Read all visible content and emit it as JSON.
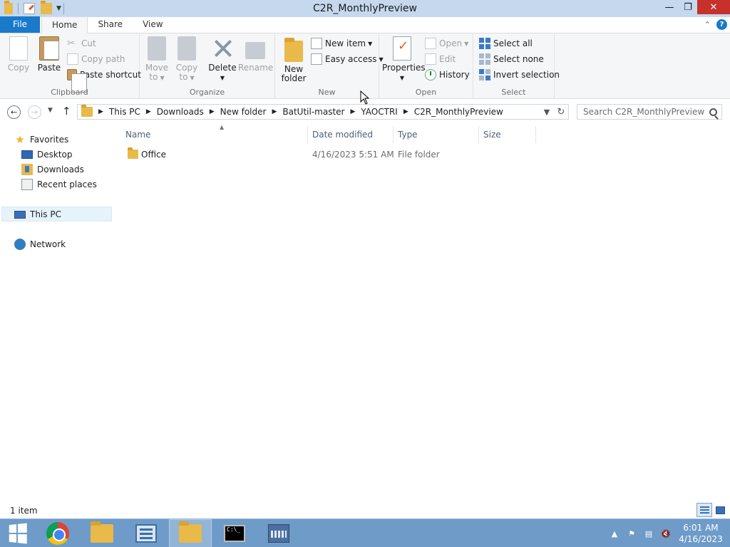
{
  "window": {
    "title": "C2R_MonthlyPreview"
  },
  "ribbon_tabs": [
    {
      "label": "File"
    },
    {
      "label": "Home"
    },
    {
      "label": "Share"
    },
    {
      "label": "View"
    }
  ],
  "ribbon": {
    "clipboard": {
      "label": "Clipboard",
      "copy": "Copy",
      "paste": "Paste",
      "cut": "Cut",
      "copy_path": "Copy path",
      "paste_shortcut": "Paste shortcut"
    },
    "organize": {
      "label": "Organize",
      "move_to_1": "Move",
      "move_to_2": "to",
      "copy_to_1": "Copy",
      "copy_to_2": "to",
      "delete": "Delete",
      "rename": "Rename"
    },
    "new": {
      "label": "New",
      "new_folder_1": "New",
      "new_folder_2": "folder",
      "new_item": "New item",
      "easy_access": "Easy access"
    },
    "open": {
      "label": "Open",
      "properties": "Properties",
      "open": "Open",
      "edit": "Edit",
      "history": "History"
    },
    "select": {
      "label": "Select",
      "select_all": "Select all",
      "select_none": "Select none",
      "invert_selection": "Invert selection"
    }
  },
  "address": {
    "crumbs": [
      "This PC",
      "Downloads",
      "New folder",
      "BatUtil-master",
      "YAOCTRI",
      "C2R_MonthlyPreview"
    ]
  },
  "search": {
    "placeholder": "Search C2R_MonthlyPreview"
  },
  "nav": {
    "favorites": "Favorites",
    "desktop": "Desktop",
    "downloads": "Downloads",
    "recent_places": "Recent places",
    "this_pc": "This PC",
    "network": "Network"
  },
  "columns": {
    "name": "Name",
    "date_modified": "Date modified",
    "type": "Type",
    "size": "Size"
  },
  "files": [
    {
      "name": "Office",
      "date_modified": "4/16/2023 5:51 AM",
      "type": "File folder",
      "size": ""
    }
  ],
  "status": {
    "item_count": "1 item"
  },
  "taskbar": {
    "clock_time": "6:01 AM",
    "clock_date": "4/16/2023",
    "cmd_text": "C:\\_"
  },
  "colors": {
    "accent": "#1979ca",
    "titlebar": "#c5d8ee",
    "taskbar": "#6e9bc8",
    "close": "#c7312b"
  }
}
